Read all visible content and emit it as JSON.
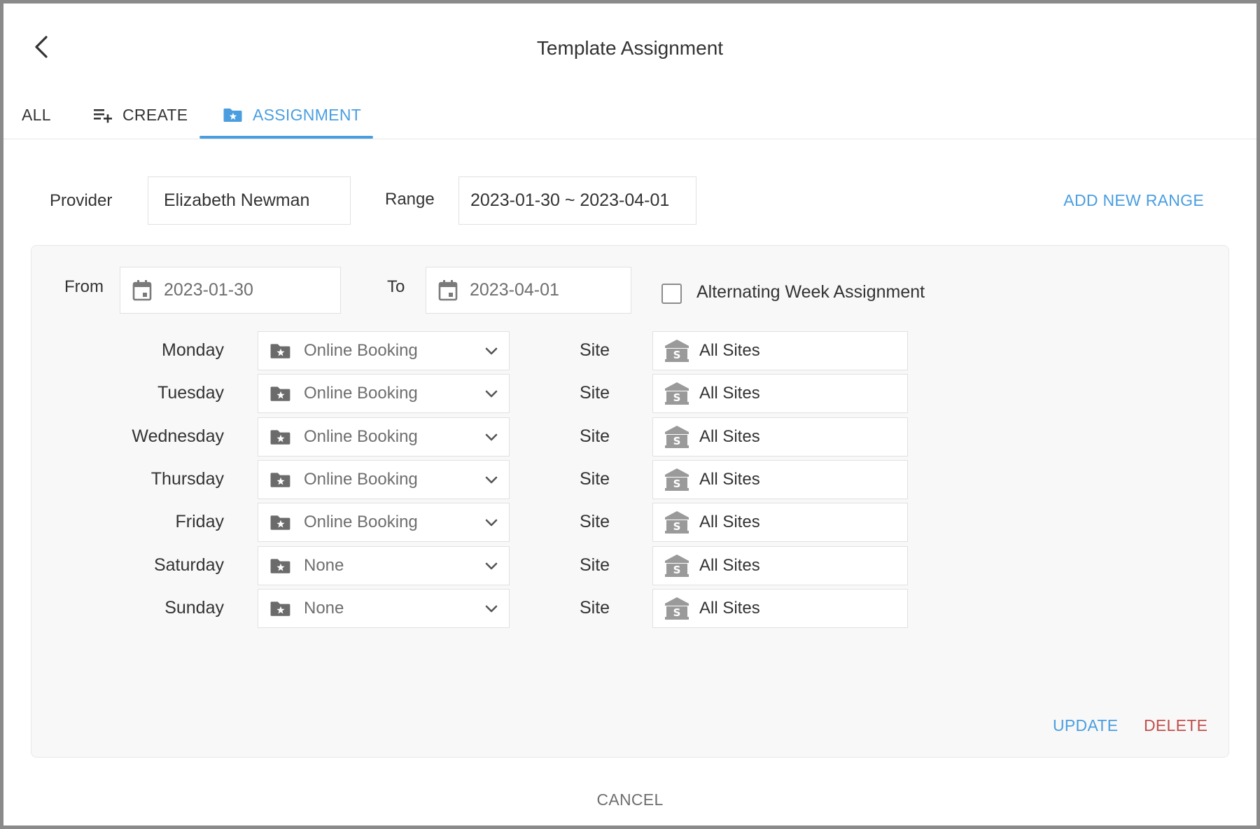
{
  "dialog": {
    "title": "Template Assignment"
  },
  "tabs": [
    {
      "label": "ALL",
      "icon": "",
      "active": false
    },
    {
      "label": "CREATE",
      "icon": "playlist-add-icon",
      "active": false
    },
    {
      "label": "ASSIGNMENT",
      "icon": "folder-star-icon",
      "active": true
    }
  ],
  "form": {
    "provider_label": "Provider",
    "provider_value": "Elizabeth Newman",
    "range_label": "Range",
    "range_value": "2023-01-30 ~ 2023-04-01",
    "add_range_label": "ADD NEW RANGE"
  },
  "panel": {
    "from_label": "From",
    "from_value": "2023-01-30",
    "to_label": "To",
    "to_value": "2023-04-01",
    "alternating_label": "Alternating Week Assignment",
    "alternating_checked": false,
    "site_label": "Site",
    "days": [
      {
        "day": "Monday",
        "template": "Online Booking",
        "site": "All Sites"
      },
      {
        "day": "Tuesday",
        "template": "Online Booking",
        "site": "All Sites"
      },
      {
        "day": "Wednesday",
        "template": "Online Booking",
        "site": "All Sites"
      },
      {
        "day": "Thursday",
        "template": "Online Booking",
        "site": "All Sites"
      },
      {
        "day": "Friday",
        "template": "Online Booking",
        "site": "All Sites"
      },
      {
        "day": "Saturday",
        "template": "None",
        "site": "All Sites"
      },
      {
        "day": "Sunday",
        "template": "None",
        "site": "All Sites"
      }
    ],
    "update_label": "UPDATE",
    "delete_label": "DELETE"
  },
  "footer": {
    "cancel_label": "CANCEL"
  },
  "colors": {
    "accent": "#4a9ee0",
    "danger": "#c0504d",
    "text": "#333333",
    "muted": "#6e6e6e",
    "icon_gray": "#6b6b6b"
  }
}
